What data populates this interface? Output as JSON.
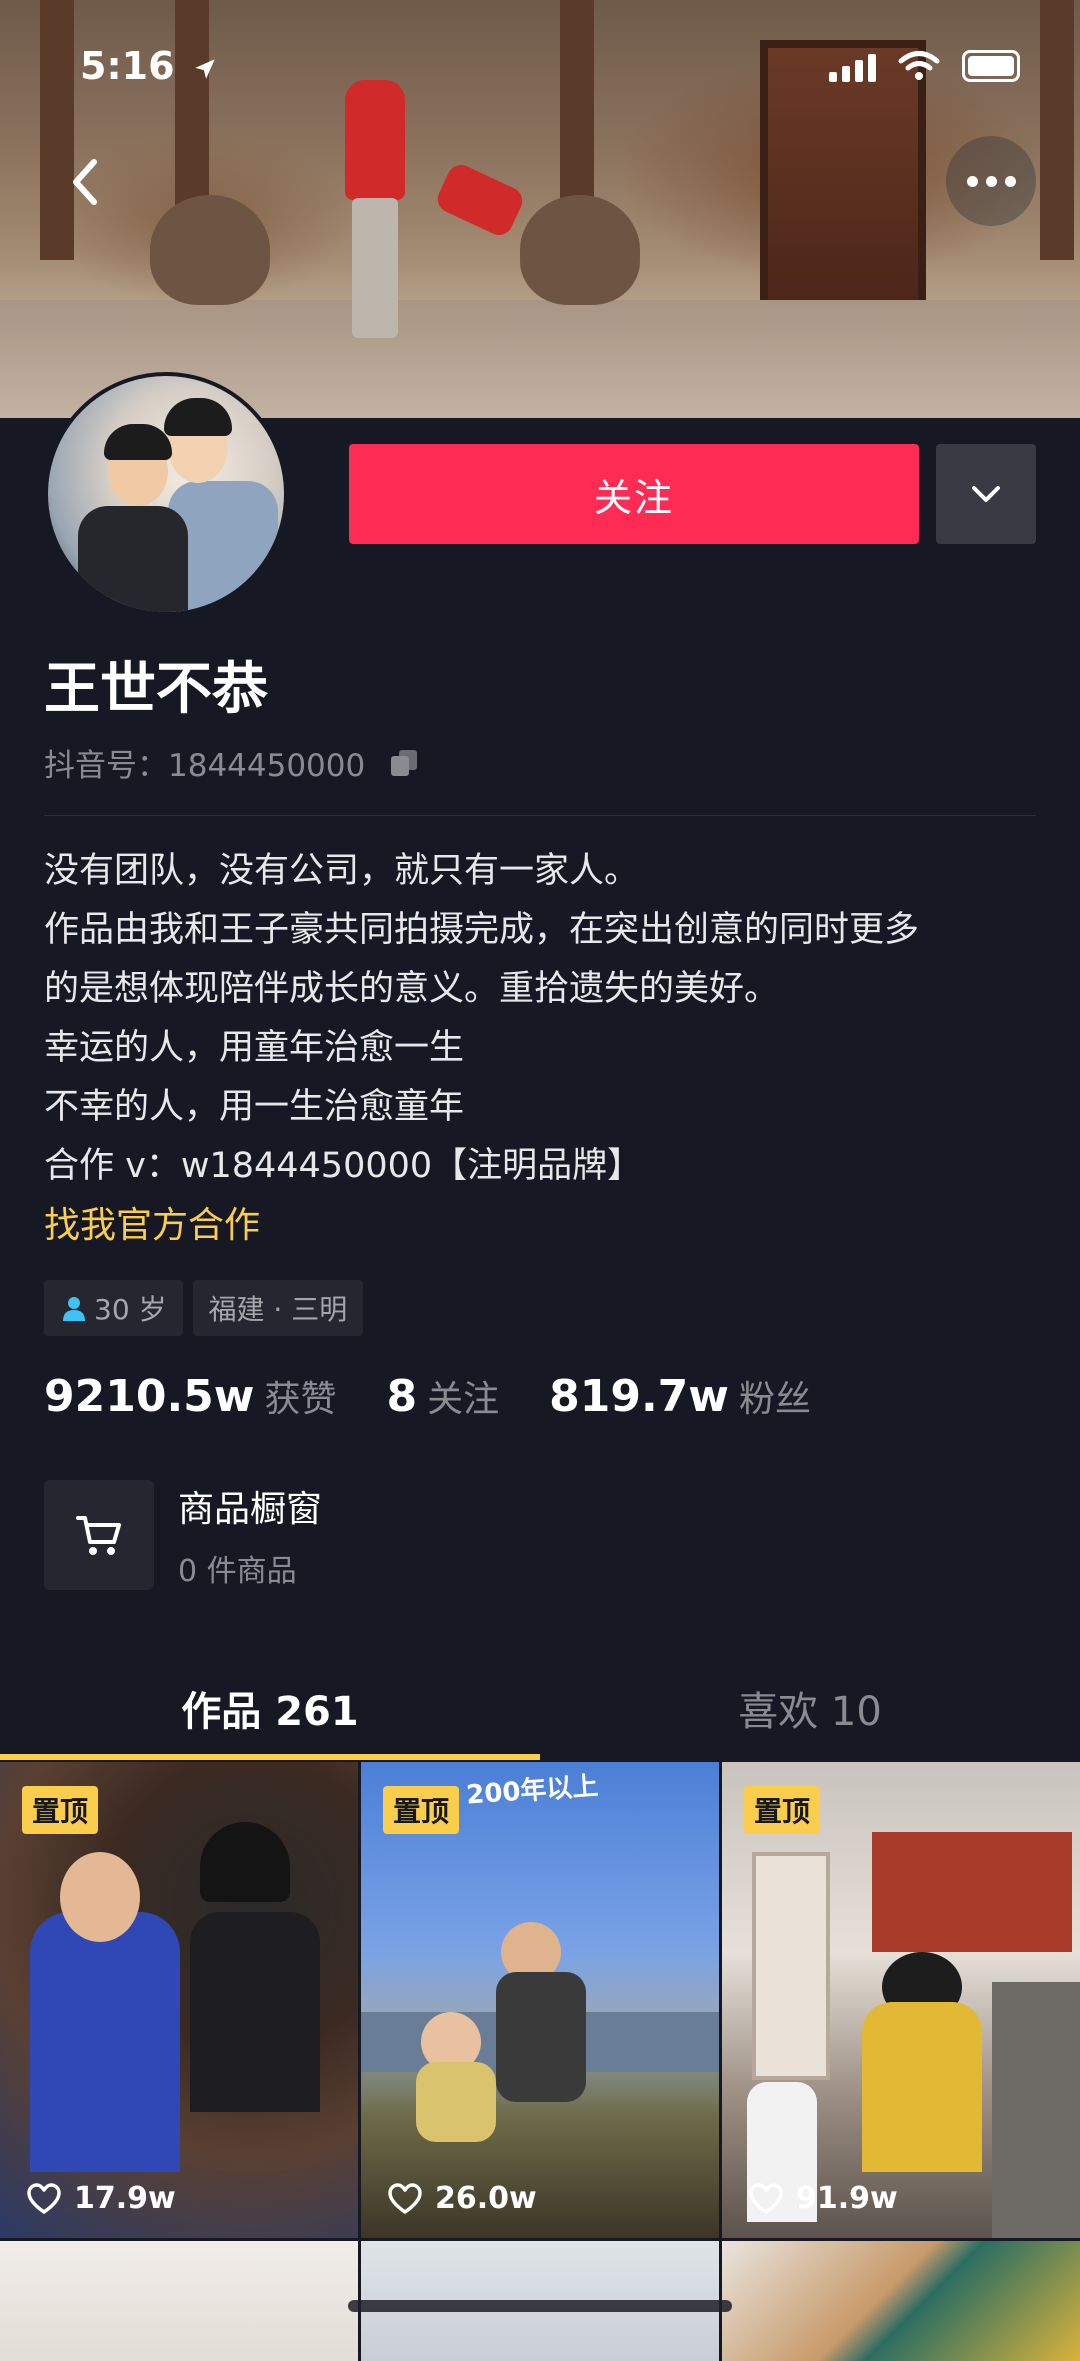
{
  "status_bar": {
    "time": "5:16"
  },
  "profile": {
    "follow_label": "关注",
    "username": "王世不恭",
    "douyin_id": "抖音号：1844450000",
    "bio_lines": [
      "没有团队，没有公司，就只有一家人。",
      "作品由我和王子豪共同拍摄完成，在突出创意的同时更多",
      "的是想体现陪伴成长的意义。重拾遗失的美好。",
      "幸运的人，用童年治愈一生",
      "不幸的人，用一生治愈童年",
      "合作 v：w1844450000【注明品牌】"
    ],
    "official_link": "找我官方合作",
    "tags": {
      "age": "30 岁",
      "location": "福建 · 三明"
    },
    "stats": {
      "likes_value": "9210.5w",
      "likes_label": "获赞",
      "following_value": "8",
      "following_label": "关注",
      "fans_value": "819.7w",
      "fans_label": "粉丝"
    },
    "shop": {
      "title": "商品橱窗",
      "subtitle": "0 件商品"
    }
  },
  "tabs": [
    {
      "label": "作品 261"
    },
    {
      "label": "喜欢 10"
    }
  ],
  "videos": [
    {
      "pinned": "置顶",
      "likes": "17.9w"
    },
    {
      "pinned": "置顶",
      "likes": "26.0w",
      "overlay": "200年以上"
    },
    {
      "pinned": "置顶",
      "likes": "91.9w"
    }
  ],
  "colors": {
    "background": "#161823",
    "follow_button": "#fe2c55",
    "accent_yellow": "#facd4c",
    "muted_text": "#8a8b91"
  }
}
